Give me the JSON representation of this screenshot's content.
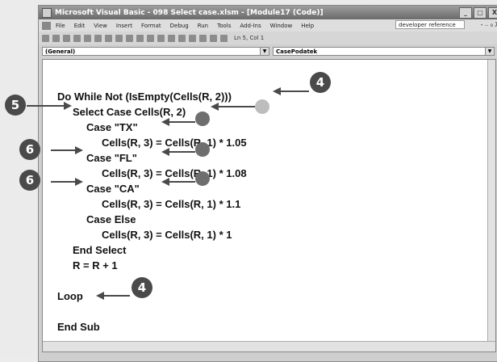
{
  "window": {
    "title": "Microsoft Visual Basic - 098 Select case.xlsm - [Module17 (Code)]",
    "buttons": [
      "_",
      "□",
      "X"
    ]
  },
  "menubar": {
    "items": [
      "File",
      "Edit",
      "View",
      "Insert",
      "Format",
      "Debug",
      "Run",
      "Tools",
      "Add-Ins",
      "Window",
      "Help"
    ],
    "help_search": "developer reference",
    "right_controls": "- ₋ ₀ X"
  },
  "toolbar": {
    "position": "Ln 5, Col 1"
  },
  "combos": {
    "object": "(General)",
    "procedure": "CasePodatek"
  },
  "code": {
    "lines": [
      "Do While Not (IsEmpty(Cells(R, 2)))",
      "Select Case Cells(R, 2)",
      "Case \"TX\"",
      "Cells(R, 3) = Cells(R, 1) * 1.05",
      "Case \"FL\"",
      "Cells(R, 3) = Cells(R, 1) * 1.08",
      "Case \"CA\"",
      "Cells(R, 3) = Cells(R, 1) * 1.1",
      "Case Else",
      "Cells(R, 3) = Cells(R, 1) * 1",
      "End Select",
      "R = R + 1",
      "Loop",
      "End Sub"
    ]
  },
  "callouts": {
    "c1": "4",
    "c2": "5",
    "c3": "6",
    "c4": "6",
    "c5": "4"
  },
  "colors": {
    "callout": "#4a4a4a",
    "marker_dark": "#6e6e6e",
    "marker_light": "#bdbdbd"
  }
}
